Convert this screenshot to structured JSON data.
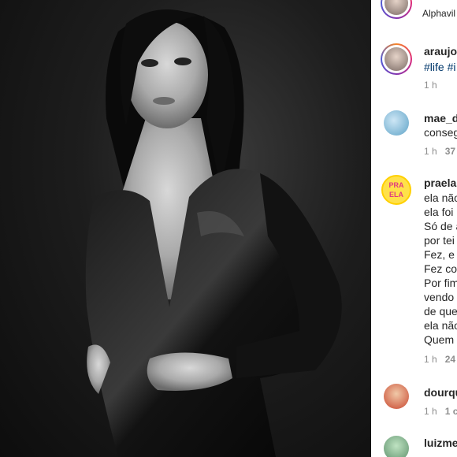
{
  "post": {
    "location": "Alphavil"
  },
  "comments": [
    {
      "username": "araujov",
      "lines": [
        "#life #i"
      ],
      "time": "1 h",
      "likes": ""
    },
    {
      "username": "mae_d",
      "lines": [
        "conseg"
      ],
      "time": "1 h",
      "likes": "37"
    },
    {
      "username": "praela",
      "lines": [
        "ela não",
        "ela foi",
        "Só de a",
        "por tei",
        "Fez, e",
        "Fez co",
        "Por fim",
        "vendo",
        "de que",
        "ela não",
        "Quem"
      ],
      "time": "1 h",
      "likes": "24"
    },
    {
      "username": "dourqu",
      "lines": [],
      "time": "1 h",
      "likes": "1 c"
    },
    {
      "username": "luizme",
      "lines": [],
      "time": "",
      "likes": ""
    }
  ],
  "badge_text": {
    "line1": "PRA",
    "line2": "ELA"
  },
  "colors": {
    "username": "#262626",
    "hashtag": "#00376b",
    "meta": "#8e8e8e",
    "photo_bg": "#1d1d1d"
  },
  "icons": [
    "story-ring-avatar",
    "user-avatar"
  ]
}
